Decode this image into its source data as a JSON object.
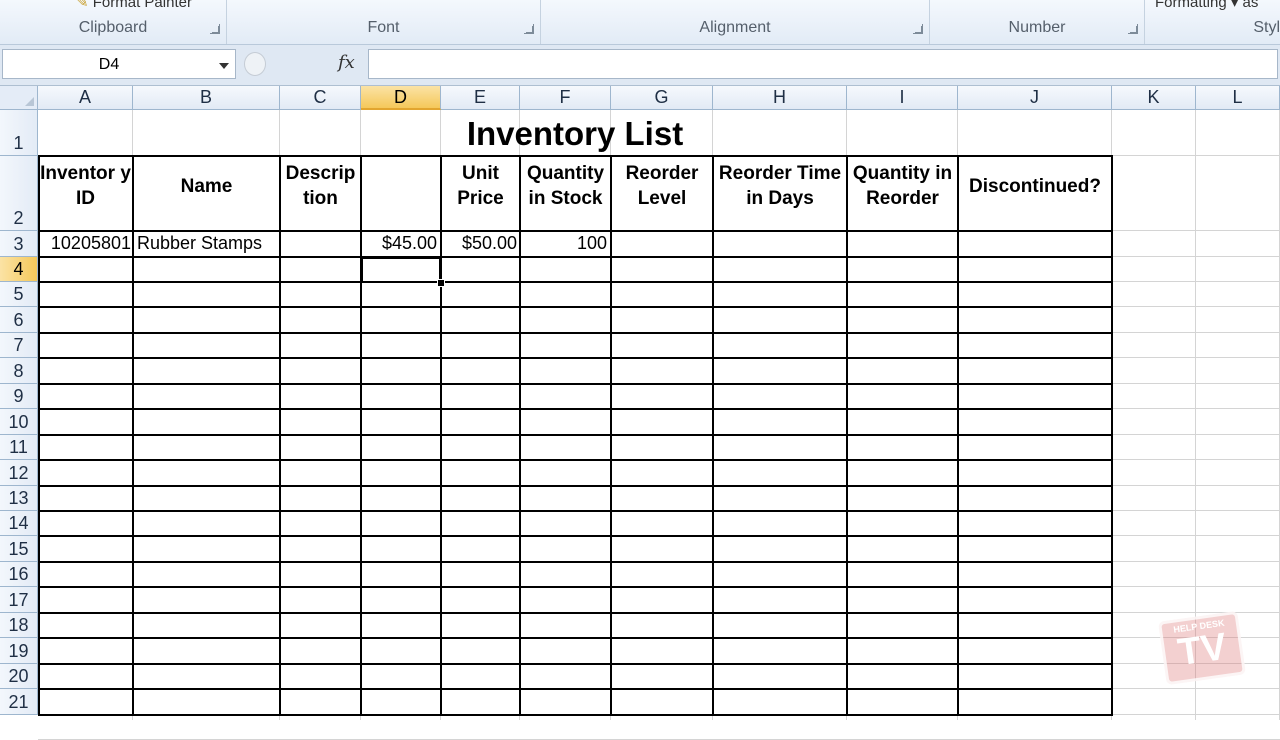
{
  "ribbon": {
    "clipboard": {
      "label": "Clipboard",
      "format_painter": "Format Painter"
    },
    "font": {
      "label": "Font"
    },
    "alignment": {
      "label": "Alignment"
    },
    "number": {
      "label": "Number"
    },
    "styles": {
      "label": "Styl",
      "conditional_formatting": "Formatting ▾ as"
    }
  },
  "formula_bar": {
    "name_box": "D4",
    "fx": "fx",
    "formula": ""
  },
  "columns": [
    "A",
    "B",
    "C",
    "D",
    "E",
    "F",
    "G",
    "H",
    "I",
    "J",
    "K",
    "L"
  ],
  "selected_column": "D",
  "rows": [
    "1",
    "2",
    "3",
    "4",
    "5",
    "6",
    "7",
    "8",
    "9",
    "10",
    "11",
    "12",
    "13",
    "14",
    "15",
    "16",
    "17",
    "18",
    "19",
    "20",
    "21"
  ],
  "selected_row": "4",
  "sheet": {
    "title": "Inventory List",
    "headers": {
      "A": "Inventor y ID",
      "B": "Name",
      "C": "Descrip tion",
      "D": "",
      "E": "Unit Price",
      "F": "Quantity in Stock",
      "G": "Reorder Level",
      "H": "Reorder Time in Days",
      "I": "Quantity in Reorder",
      "J": "Discontinued?"
    },
    "row3": {
      "A": "10205801",
      "B": "Rubber Stamps",
      "D": "$45.00",
      "E": "$50.00",
      "F": "100"
    }
  },
  "watermark": {
    "small": "HELP DESK",
    "big": "TV"
  }
}
